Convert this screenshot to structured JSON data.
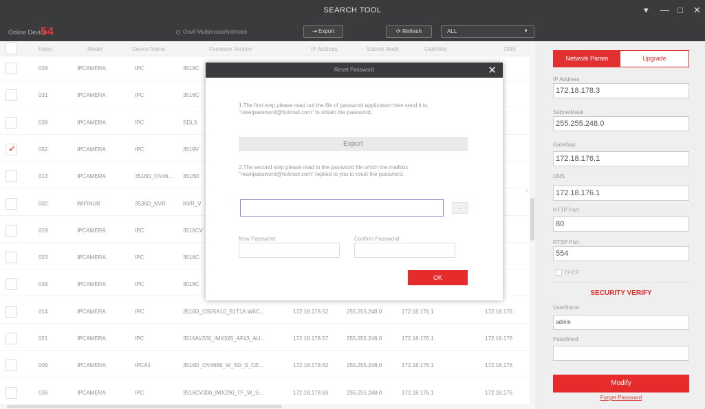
{
  "window": {
    "title": "SEARCH TOOL",
    "controls": {
      "settings": "▾",
      "minimize": "—",
      "maximize": "□",
      "close": "✕"
    }
  },
  "toolbar": {
    "online_label": "Online Device",
    "online_count": "54",
    "onvif_label": "Onvif Multimodal/Netmask",
    "export_label": "Export",
    "refresh_label": "Refresh",
    "filter_value": "ALL"
  },
  "table": {
    "headers": [
      "Index",
      "Model",
      "Device Name",
      "Firmware Version",
      "IP Address",
      "Subnet Mask",
      "GateWay",
      "DNS"
    ],
    "rows": [
      {
        "index": "029",
        "model": "IPCAMERA",
        "name": "IPC",
        "firmware": "3516C",
        "ip": "",
        "mask": "",
        "gateway": "",
        "dns": "8.176",
        "checked": false
      },
      {
        "index": "031",
        "model": "IPCAMERA",
        "name": "IPC",
        "firmware": "3516C",
        "ip": "",
        "mask": "",
        "gateway": "",
        "dns": "8.176",
        "checked": false
      },
      {
        "index": "039",
        "model": "IPCAMERA",
        "name": "IPC",
        "firmware": "SDL3",
        "ip": "",
        "mask": "",
        "gateway": "",
        "dns": "8.176",
        "checked": false
      },
      {
        "index": "052",
        "model": "IPCAMERA",
        "name": "IPC",
        "firmware": "3519V",
        "ip": "",
        "mask": "",
        "gateway": "",
        "dns": "8.176",
        "checked": true
      },
      {
        "index": "013",
        "model": "IPCAMERA",
        "name": "3516D_OV46...",
        "firmware": "3516D",
        "ip": "",
        "mask": "",
        "gateway": "",
        "dns": "8.176",
        "checked": false
      },
      {
        "index": "002",
        "model": "WIFINVR",
        "name": "3536D_NVR",
        "firmware": "NVR_V",
        "ip": "",
        "mask": "",
        "gateway": "",
        "dns": "8.176",
        "checked": false
      },
      {
        "index": "019",
        "model": "IPCAMERA",
        "name": "IPC",
        "firmware": "3516CV",
        "ip": "",
        "mask": "",
        "gateway": "",
        "dns": "8.176",
        "checked": false
      },
      {
        "index": "023",
        "model": "IPCAMERA",
        "name": "IPC",
        "firmware": "3516C",
        "ip": "",
        "mask": "",
        "gateway": "",
        "dns": "8.176",
        "checked": false
      },
      {
        "index": "033",
        "model": "IPCAMERA",
        "name": "IPC",
        "firmware": "3016C",
        "ip": "",
        "mask": "",
        "gateway": "",
        "dns": "8.176",
        "checked": false
      },
      {
        "index": "014",
        "model": "IPCAMERA",
        "name": "IPC",
        "firmware": "3516D_OS05A10_B1T1A.W6C...",
        "ip": "172.18.178.52",
        "mask": "255.255.248.0",
        "gateway": "172.18.176.1",
        "dns": "172.18.176",
        "checked": false
      },
      {
        "index": "021",
        "model": "IPCAMERA",
        "name": "IPC",
        "firmware": "3516AV200_IMX326_AF43_AU...",
        "ip": "172.18.178.57",
        "mask": "255.255.248.0",
        "gateway": "172.18.176.1",
        "dns": "172.18.176",
        "checked": false
      },
      {
        "index": "009",
        "model": "IPCAMERA",
        "name": "IPCAJ",
        "firmware": "3516D_OV4689_W_SD_S_CE...",
        "ip": "172.18.178.62",
        "mask": "255.255.248.0",
        "gateway": "172.18.176.1",
        "dns": "172.18.176",
        "checked": false
      },
      {
        "index": "036",
        "model": "IPCAMERA",
        "name": "IPC",
        "firmware": "3516CV300_IMX290_TF_W_S...",
        "ip": "172.18.178.63",
        "mask": "255.255.248.0",
        "gateway": "172.18.176.1",
        "dns": "172.18.176",
        "checked": false
      }
    ]
  },
  "dialog": {
    "title": "Reset Password",
    "step1": "1.The first step please read out the file of password application then send it to \"resetpassword@hotmail.com\" to obtain the password.",
    "export_label": "Export",
    "step2": "2.The second step please read in the password file which the mailbox \"resetpassword@hotmail.com\" replied to you to reset the password.",
    "browse_label": "...",
    "new_password_label": "New Password",
    "confirm_password_label": "Confirm Password",
    "ok_label": "OK"
  },
  "panel": {
    "tab_network": "Network Param",
    "tab_upgrade": "Upgrade",
    "ip_label": "IP Address",
    "ip_value": "172.18.178.3",
    "mask_label": "SubnetMask",
    "mask_value": "255.255.248.0",
    "gateway_label": "GateWay",
    "gateway_value": "172.18.176.1",
    "dns_label": "DNS",
    "dns_value": "172.18.176.1",
    "http_label": "HTTP Port",
    "http_value": "80",
    "rtsp_label": "RTSP Port",
    "rtsp_value": "554",
    "dhcp_label": "DHCP",
    "security_title": "SECURITY VERIFY",
    "username_label": "UserName",
    "username_value": "admin",
    "password_label": "PassWord",
    "password_value": "",
    "modify_label": "Modify",
    "forgot_label": "Forget Password"
  },
  "colors": {
    "accent": "#e52b2b",
    "titlebar": "#3a3b3d"
  }
}
